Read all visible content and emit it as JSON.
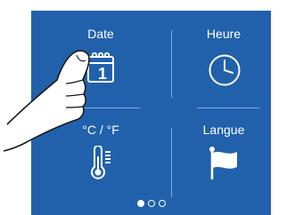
{
  "tiles": [
    {
      "id": "date",
      "label": "Date",
      "icon": "calendar-icon",
      "calendar_day": "1"
    },
    {
      "id": "heure",
      "label": "Heure",
      "icon": "clock-icon"
    },
    {
      "id": "temperature-unit",
      "label": "°C / °F",
      "icon": "thermometer-icon"
    },
    {
      "id": "langue",
      "label": "Langue",
      "icon": "flag-icon"
    }
  ],
  "pager": {
    "pages": 3,
    "current": 1
  },
  "colors": {
    "screen": "#2161ac",
    "foreground": "#ffffff"
  }
}
